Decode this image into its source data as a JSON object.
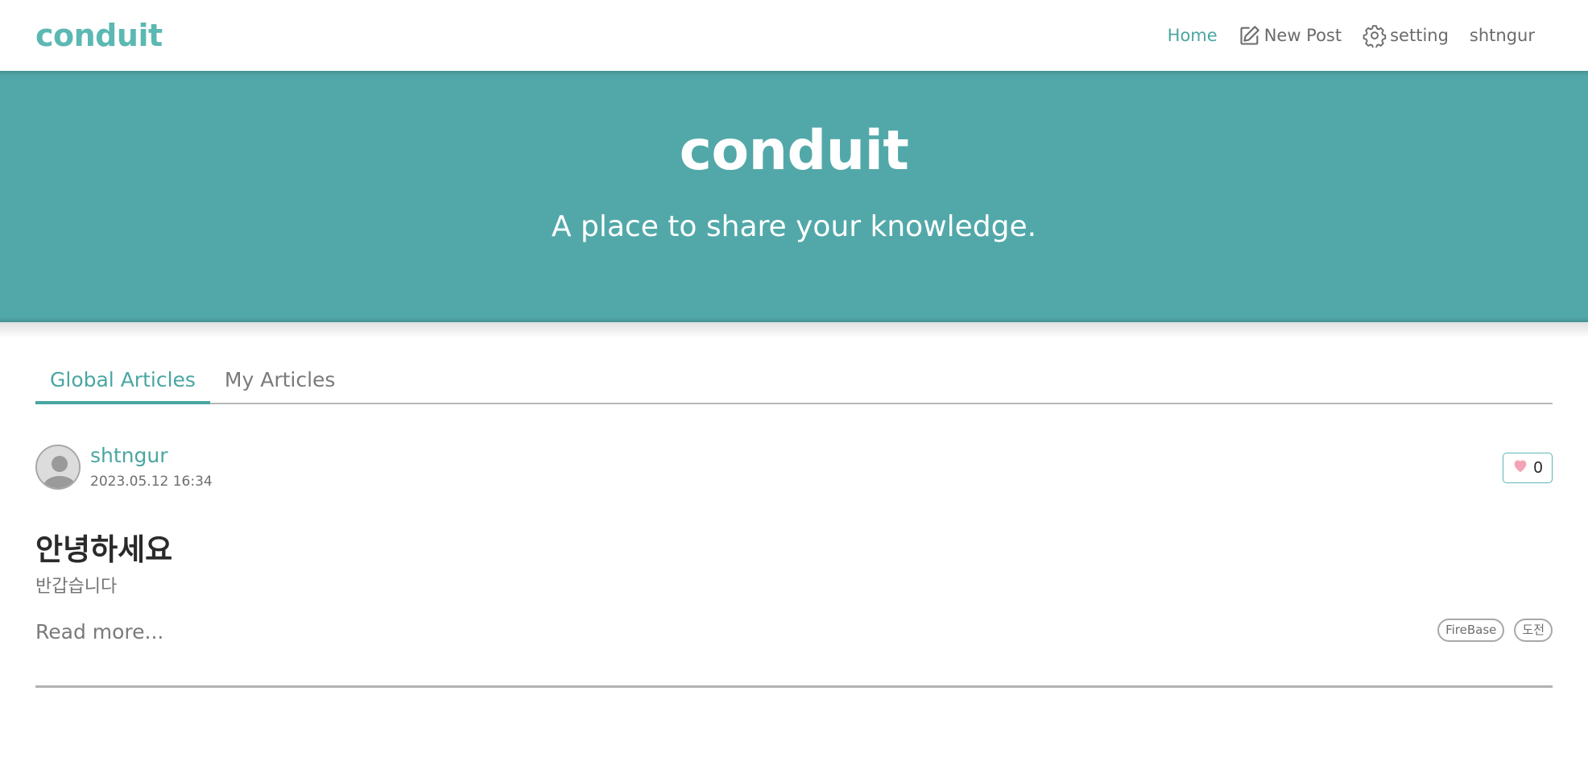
{
  "navbar": {
    "brand": "conduit",
    "links": {
      "home": "Home",
      "new_post": "New Post",
      "setting": "setting",
      "user": "shtngur"
    },
    "icons": {
      "new_post": "edit-icon",
      "setting": "gear-icon"
    }
  },
  "hero": {
    "title": "conduit",
    "subtitle": "A place to share your knowledge."
  },
  "tabs": [
    {
      "label": "Global Articles",
      "active": true
    },
    {
      "label": "My Articles",
      "active": false
    }
  ],
  "articles": [
    {
      "author": "shtngur",
      "date": "2023.05.12 16:34",
      "like_count": "0",
      "title": "안녕하세요",
      "description": "반갑습니다",
      "read_more": "Read more...",
      "tags": [
        "FireBase",
        "도전"
      ]
    }
  ],
  "colors": {
    "accent": "#4aa6a2",
    "brand": "#5cb8b2",
    "hero_bg": "#52a8a9",
    "heart": "#f4a3b6"
  }
}
